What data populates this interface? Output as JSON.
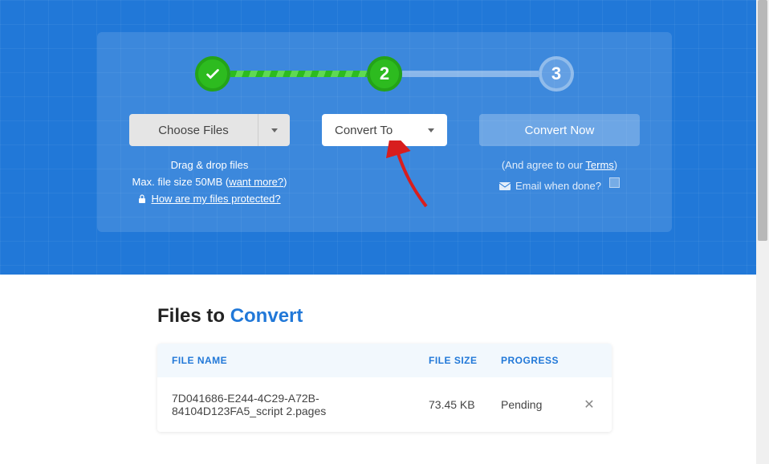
{
  "stepper": {
    "step2_label": "2",
    "step3_label": "3"
  },
  "buttons": {
    "choose_files": "Choose Files",
    "convert_to": "Convert To",
    "convert_now": "Convert Now"
  },
  "hints": {
    "drag_drop": "Drag & drop files",
    "max_size": "Max. file size 50MB (",
    "want_more": "want more?",
    "max_size_close": ")",
    "protected": "How are my files protected?",
    "agree_prefix": "(And agree to our ",
    "terms": "Terms",
    "agree_suffix": ")",
    "email_done": "Email when done?"
  },
  "files_section": {
    "heading_prefix": "Files to ",
    "heading_accent": "Convert",
    "columns": {
      "name": "FILE NAME",
      "size": "FILE SIZE",
      "progress": "PROGRESS"
    },
    "rows": [
      {
        "name": "7D041686-E244-4C29-A72B-84104D123FA5_script 2.pages",
        "size": "73.45 KB",
        "progress": "Pending"
      }
    ]
  }
}
